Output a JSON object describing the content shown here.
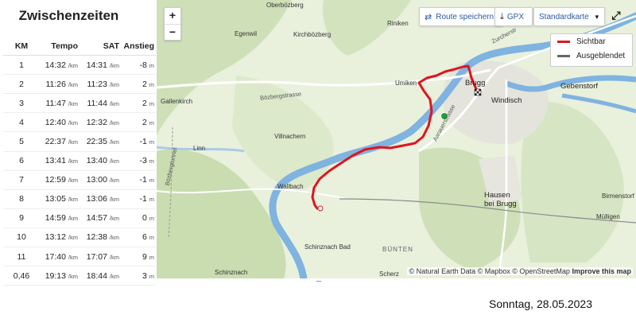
{
  "panel": {
    "title": "Zwischenzeiten",
    "headers": [
      "KM",
      "Tempo",
      "SAT",
      "Anstieg"
    ],
    "rows": [
      {
        "km": "1",
        "tempo": "14:32",
        "sat": "14:31",
        "anstieg": "-8"
      },
      {
        "km": "2",
        "tempo": "11:26",
        "sat": "11:23",
        "anstieg": "2"
      },
      {
        "km": "3",
        "tempo": "11:47",
        "sat": "11:44",
        "anstieg": "2"
      },
      {
        "km": "4",
        "tempo": "12:40",
        "sat": "12:32",
        "anstieg": "2"
      },
      {
        "km": "5",
        "tempo": "22:37",
        "sat": "22:35",
        "anstieg": "-1"
      },
      {
        "km": "6",
        "tempo": "13:41",
        "sat": "13:40",
        "anstieg": "-3"
      },
      {
        "km": "7",
        "tempo": "12:59",
        "sat": "13:00",
        "anstieg": "-1"
      },
      {
        "km": "8",
        "tempo": "13:05",
        "sat": "13:06",
        "anstieg": "-1"
      },
      {
        "km": "9",
        "tempo": "14:59",
        "sat": "14:57",
        "anstieg": "0"
      },
      {
        "km": "10",
        "tempo": "13:12",
        "sat": "12:38",
        "anstieg": "6"
      },
      {
        "km": "11",
        "tempo": "17:40",
        "sat": "17:07",
        "anstieg": "9"
      },
      {
        "km": "0,46",
        "tempo": "19:13",
        "sat": "18:44",
        "anstieg": "3"
      }
    ],
    "pace_unit": "/km",
    "elev_unit": "m"
  },
  "map": {
    "zoom_in": "+",
    "zoom_out": "−",
    "route_save": "Route speichern",
    "gpx": "GPX",
    "map_style": "Standardkarte",
    "legend_visible": "Sichtbar",
    "legend_hidden": "Ausgeblendet",
    "colors": {
      "route": "#e0141e",
      "hidden": "#666666",
      "river": "#5b9bd5",
      "start": "#1e9e3a"
    },
    "places": {
      "oberbozberg": "Oberbözberg",
      "riniken": "Riniken",
      "egenwil": "Egenwil",
      "kirchbozberg": "Kirchbözberg",
      "umiken": "Umiken",
      "brugg": "Brugg",
      "gebenstorf": "Gebenstorf",
      "windisch": "Windisch",
      "gallenkirch": "Gallenkirch",
      "villnachern": "Villnachern",
      "linn": "Linn",
      "wallbach": "Wallbach",
      "hausen": "Hausen bei Brugg",
      "birmenstorf": "Birmenstorf",
      "mulligen": "Mülligen",
      "schinznach_bad": "Schinznach Bad",
      "bunten": "BÜNTEN",
      "schinznach": "Schinznach",
      "scherz": "Scherz"
    },
    "roads": {
      "bozbergstrasse": "Bözbergstrasse",
      "bozbergtunnel": "Bözbergtunnel",
      "aarauerstrasse": "Aarauerstrasse",
      "zurcherstrasse": "Zurcherstr"
    },
    "attribution": "© Natural Earth Data © Mapbox © OpenStreetMap",
    "improve": "Improve this map"
  },
  "footer": {
    "date": "Sonntag, 28.05.2023"
  }
}
